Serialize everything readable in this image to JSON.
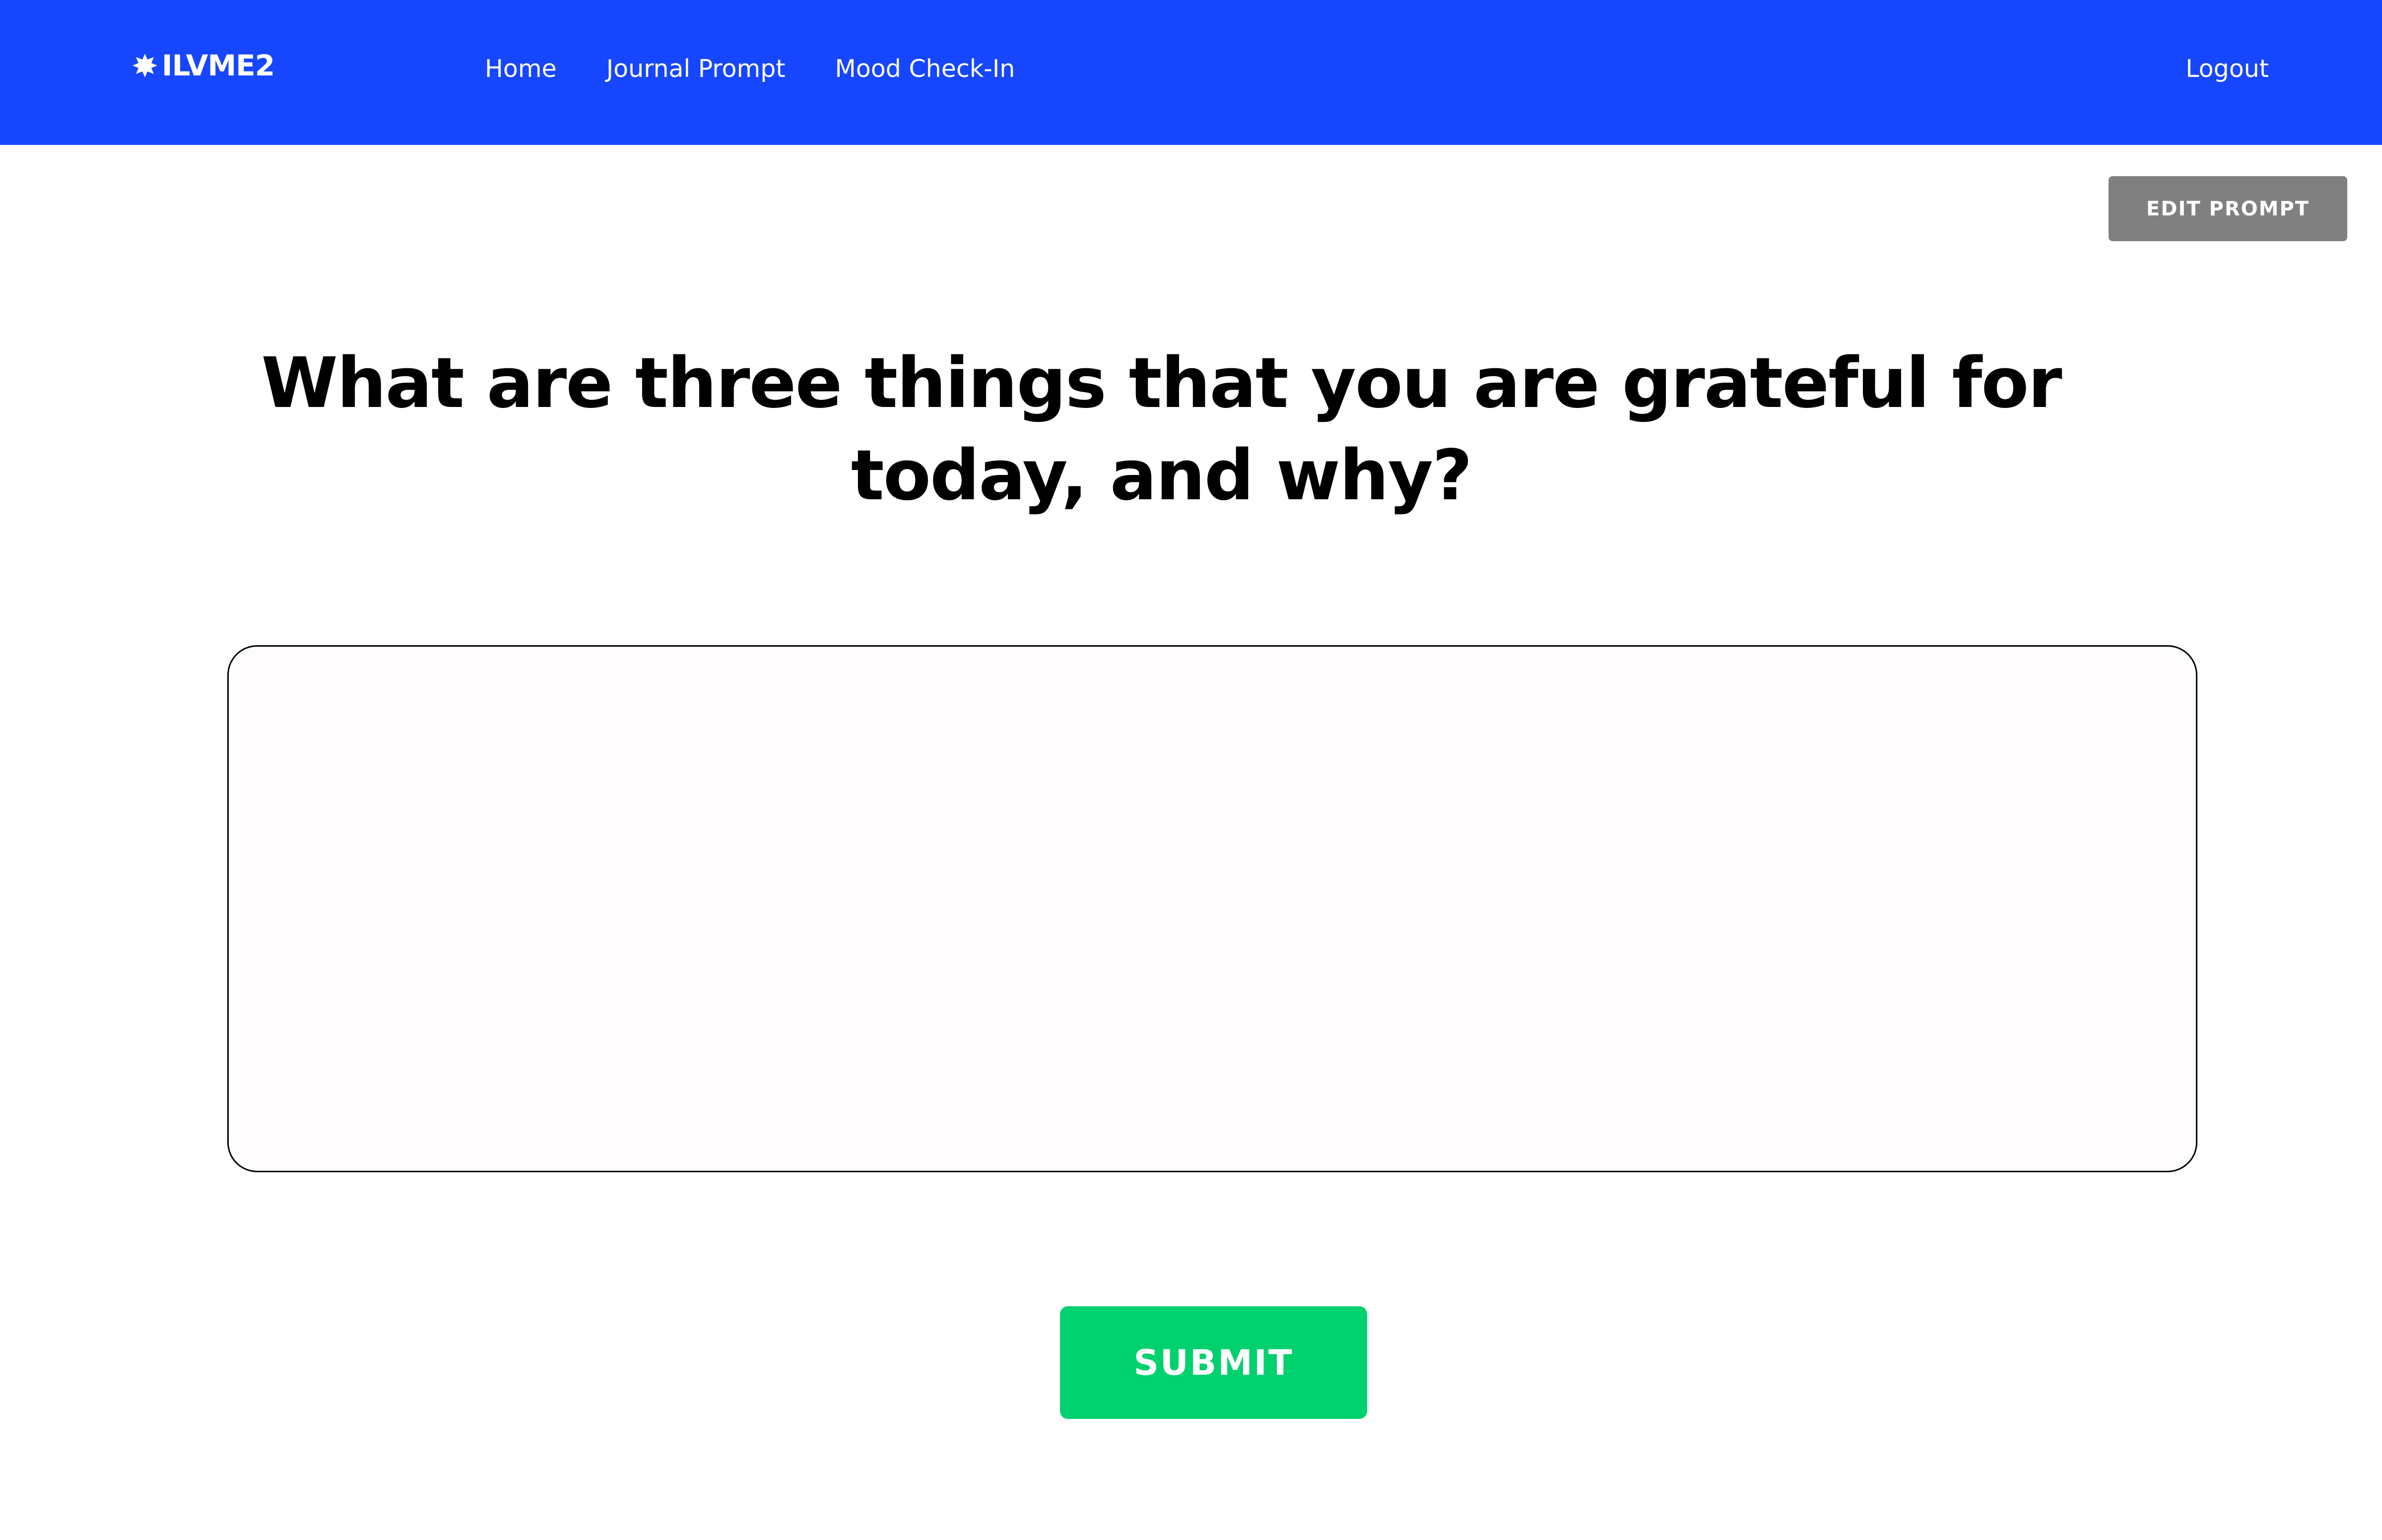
{
  "app": {
    "brand": "ILVME2",
    "brand_icon": "asterisk-badge-icon"
  },
  "nav": {
    "links": [
      {
        "label": "Home"
      },
      {
        "label": "Journal Prompt"
      },
      {
        "label": "Mood Check-In"
      }
    ],
    "logout_label": "Logout"
  },
  "toolbar": {
    "edit_label": "EDIT PROMPT"
  },
  "prompt": {
    "question": "What are three things that you are grateful for today, and why?"
  },
  "journal": {
    "value": "",
    "placeholder": ""
  },
  "actions": {
    "submit_label": "SUBMIT"
  },
  "colors": {
    "navbar": "#1746ff",
    "edit_button": "#808080",
    "submit_button": "#00d16f",
    "text": "#000000"
  }
}
